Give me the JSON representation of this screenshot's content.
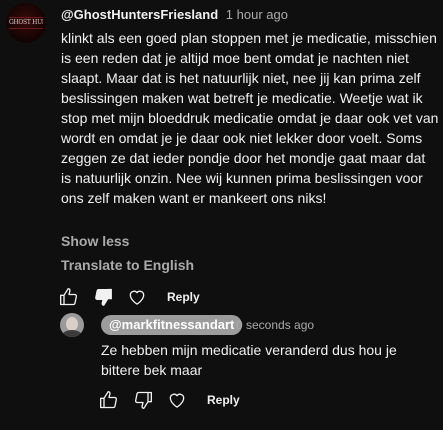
{
  "comment": {
    "author": "@GhostHuntersFriesland",
    "time": "1 hour ago",
    "avatar_logo_text": "GHOST HUNTERS FRIESLAND",
    "text": "klinkt als een goed plan stoppen met je medicatie, misschien is een reden dat je altijd moe bent omdat je nachten niet slaapt. Maar dat is het natuurlijk niet, nee jij kan prima zelf beslissingen maken wat betreft je medicatie. Weetje wat ik stop met mijn bloeddruk medicatie omdat je daar ook vet van wordt en omdat je je daar ook niet lekker door voelt. Soms zeggen ze dat ieder pondje door het mondje gaat maar dat is natuurlijk onzin. Nee wij kunnen prima beslissingen voor ons zelf maken want er mankeert ons niks!",
    "show_less": "Show less",
    "translate": "Translate to English",
    "reply_label": "Reply"
  },
  "reply": {
    "author": "@markfitnessandart",
    "time": "0 seconds ago",
    "text": "Ze hebben mijn medicatie veranderd dus hou je bittere bek maar",
    "reply_label": "Reply"
  },
  "icons": [
    "like-icon",
    "dislike-icon",
    "heart-icon"
  ],
  "colors": {
    "background": "#0f0f0f",
    "text": "#f1f1f1",
    "secondary_text": "#aaaaaa",
    "mention_pill": "#9c9c9c"
  }
}
